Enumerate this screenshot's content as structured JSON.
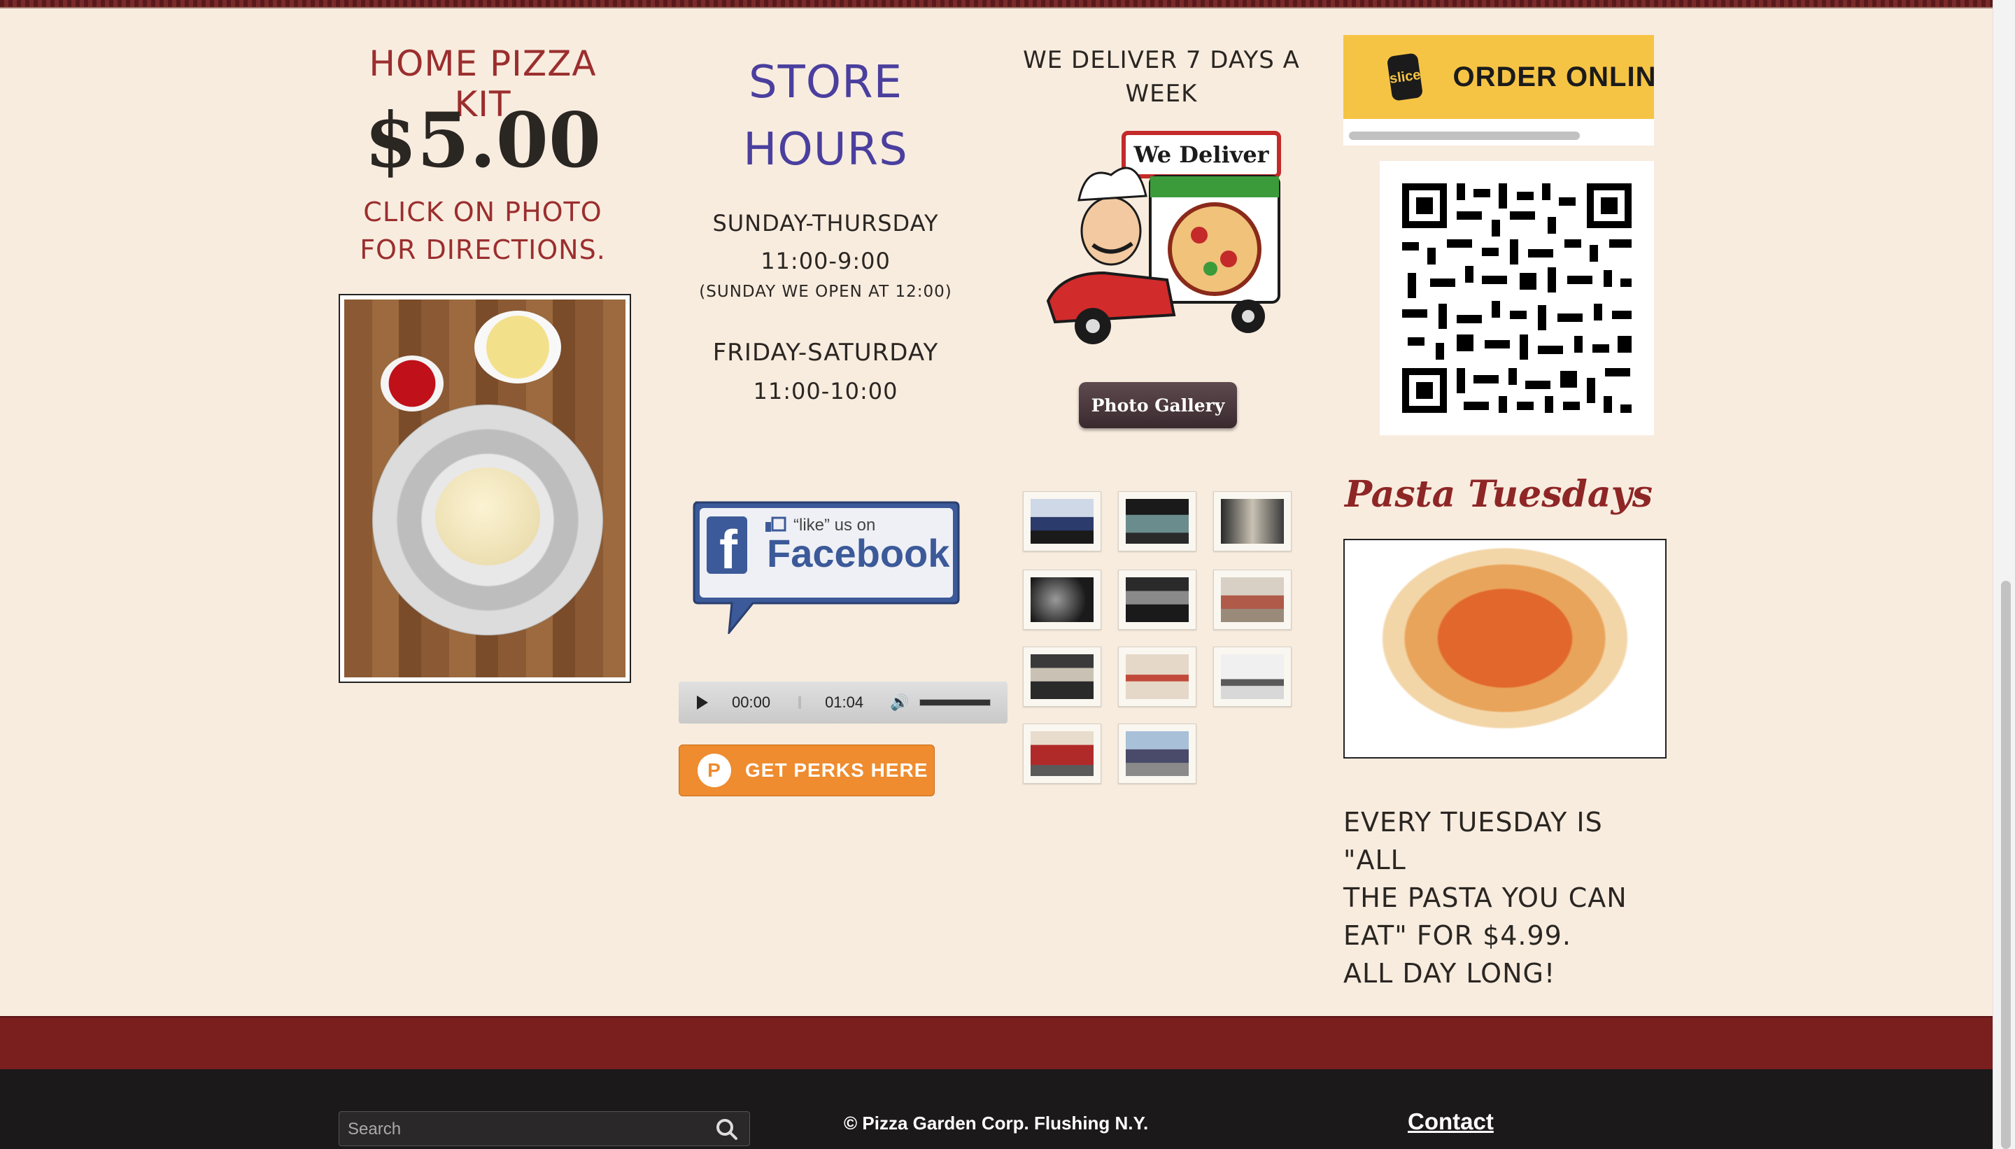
{
  "kit": {
    "title": "HOME PIZZA KIT",
    "price": "$5.00",
    "note": "CLICK ON PHOTO FOR DIRECTIONS."
  },
  "hours": {
    "title_line1": "STORE",
    "title_line2": "HOURS",
    "weekday_label": "SUNDAY-THURSDAY",
    "weekday_time": "11:00-9:00",
    "sunday_note": "(SUNDAY WE OPEN AT 12:00)",
    "weekend_label": "FRIDAY-SATURDAY",
    "weekend_time": "11:00-10:00"
  },
  "facebook": {
    "like_text": "“like” us on",
    "brand": "Facebook"
  },
  "audio": {
    "current": "00:00",
    "duration": "01:04"
  },
  "perks": {
    "icon_letter": "P",
    "label": "GET PERKS HERE"
  },
  "delivery": {
    "title": "WE DELIVER 7 DAYS A WEEK",
    "sign_text": "We Deliver",
    "gallery_button": "Photo Gallery"
  },
  "order": {
    "logo_text": "slice",
    "label": "ORDER ONLINE"
  },
  "pasta": {
    "title": "Pasta Tuesdays",
    "line1": "EVERY TUESDAY IS \"ALL",
    "line2": "THE PASTA YOU CAN",
    "line3": "EAT\" FOR $4.99.",
    "line4": "ALL DAY LONG!"
  },
  "footer": {
    "search_placeholder": "Search",
    "copyright": "© Pizza Garden Corp. Flushing N.Y.",
    "contact": "Contact"
  },
  "colors": {
    "background": "#f8ecdf",
    "accent_red": "#9b2e2e",
    "hours_purple": "#4a3f9e",
    "footer_band": "#7a1e1e",
    "footer_dark": "#1b191a",
    "perks_orange": "#ee8c2f",
    "order_yellow": "#f6c444"
  },
  "icons": [
    "play-icon",
    "volume-icon",
    "search-icon",
    "thumbs-up-icon",
    "perks-icon",
    "slice-logo-icon",
    "qr-code-icon"
  ]
}
